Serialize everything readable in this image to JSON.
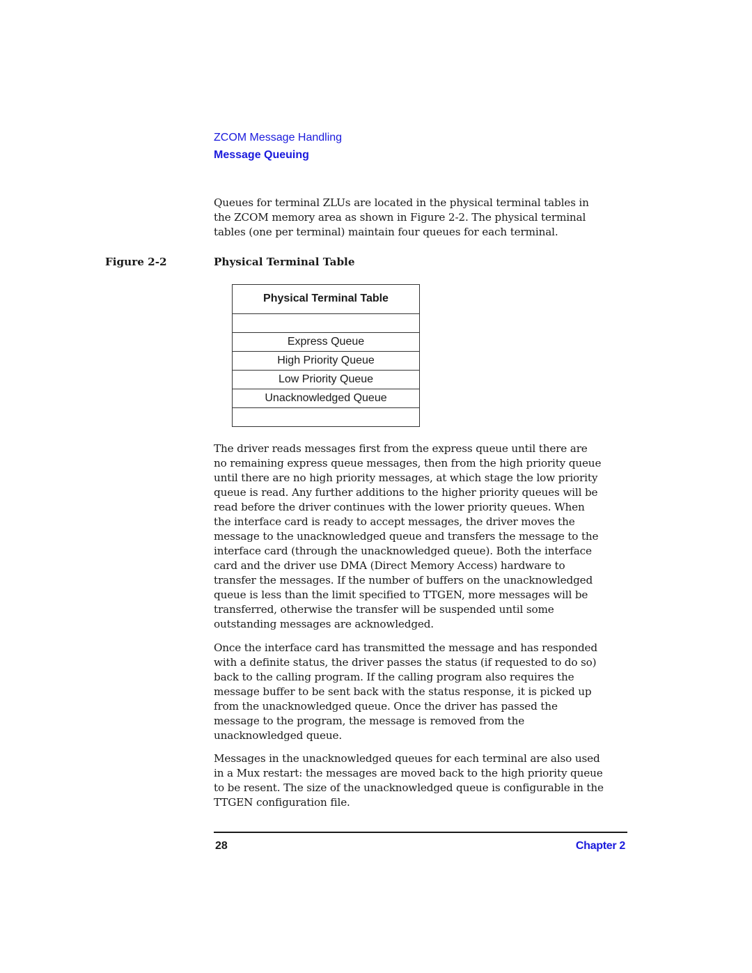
{
  "header": {
    "chapter_title": "ZCOM Message Handling",
    "section_title": "Message Queuing"
  },
  "intro_paragraph": {
    "lines": [
      "Queues for terminal ZLUs are located in the physical terminal tables in",
      "the ZCOM memory area as shown in Figure 2-2. The physical terminal",
      "tables (one per terminal) maintain four queues for each terminal."
    ]
  },
  "figure": {
    "label": "Figure 2-2",
    "title": "Physical Terminal Table",
    "table": {
      "header": "Physical Terminal Table",
      "rows": [
        "",
        "Express Queue",
        "High Priority Queue",
        "Low Priority Queue",
        "Unacknowledged Queue",
        ""
      ]
    }
  },
  "paragraphs": [
    {
      "lines": [
        "The driver reads messages first from the express queue until there are",
        "no remaining express queue messages, then from the high priority queue",
        "until there are no high priority messages, at which stage the low priority",
        "queue is read. Any further additions to the higher priority queues will be",
        "read before the driver continues with the lower priority queues. When",
        "the interface card is ready to accept messages, the driver moves the",
        "message to the unacknowledged queue and transfers the message to the",
        "interface card (through the unacknowledged queue). Both the interface",
        "card and the driver use DMA (Direct Memory Access) hardware to",
        "transfer the messages. If the number of buffers on the unacknowledged",
        "queue is less than the limit specified to TTGEN, more messages will be",
        "transferred, otherwise the transfer will be suspended until some",
        "outstanding messages are acknowledged."
      ]
    },
    {
      "lines": [
        "Once the interface card has transmitted the message and has responded",
        "with a definite status, the driver passes the status (if requested to do so)",
        "back to the calling program. If the calling program also requires the",
        "message buffer to be sent back with the status response, it is picked up",
        "from the unacknowledged queue. Once the driver has passed the",
        "message to the program, the message is removed from the",
        "unacknowledged queue."
      ]
    },
    {
      "lines": [
        "Messages in the unacknowledged queues for each terminal are also used",
        "in a Mux restart: the messages are moved back to the high priority queue",
        "to be resent. The size of the unacknowledged queue is configurable in the",
        "TTGEN configuration file."
      ]
    }
  ],
  "footer": {
    "page_number": "28",
    "chapter_label": "Chapter 2"
  },
  "colors": {
    "link_blue": "#1a1adc",
    "text": "#1a1a1a"
  }
}
